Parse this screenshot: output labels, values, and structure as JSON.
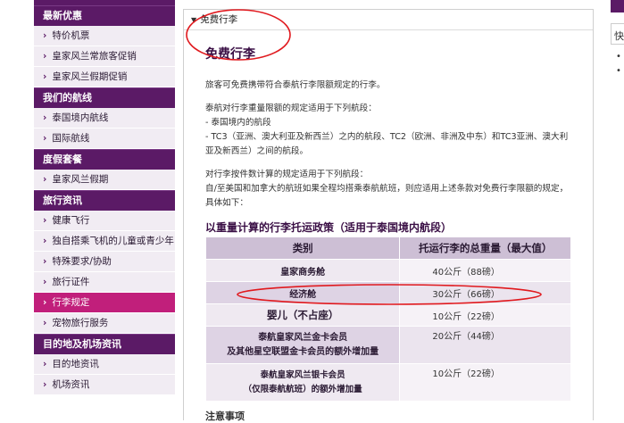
{
  "sidebar": {
    "sections": [
      {
        "header": "最新优惠",
        "items": [
          "特价机票",
          "皇家风兰常旅客促销",
          "皇家风兰假期促销"
        ]
      },
      {
        "header": "我们的航线",
        "items": [
          "泰国境内航线",
          "国际航线"
        ]
      },
      {
        "header": "度假套餐",
        "items": [
          "皇家风兰假期"
        ]
      },
      {
        "header": "旅行资讯",
        "items": [
          "健康飞行",
          "独自搭乘飞机的儿童或青少年",
          "特殊要求/协助",
          "旅行证件",
          "行李规定",
          "宠物旅行服务"
        ]
      },
      {
        "header": "目的地及机场资讯",
        "items": [
          "目的地资讯",
          "机场资讯"
        ]
      }
    ],
    "active_item": "行李规定"
  },
  "main": {
    "tab_label": "免费行李",
    "title": "免费行李",
    "paragraphs": [
      "旅客可免费携带符合泰航行李限额规定的行李。",
      "泰航对行李重量限额的规定适用于下列航段：",
      "- 泰国境内的航段",
      "- TC3（亚洲、澳大利亚及新西兰）之内的航段、TC2（欧洲、非洲及中东）和TC3亚洲、澳大利亚及新西兰）之间的航段。",
      "对行李按件数计算的规定适用于下列航段：",
      "自/至美国和加拿大的航班如果全程均搭乘泰航航班，则应适用上述条款对免费行李限额的规定，具体如下："
    ],
    "table_title": "以重量计算的行李托运政策（适用于泰国境内航段）",
    "table_headers": [
      "类别",
      "托运行李的总重量（最大值）"
    ],
    "table_rows": [
      {
        "category": "皇家商务舱",
        "weight": "40公斤（88磅）"
      },
      {
        "category": "经济舱",
        "weight": "30公斤（66磅）"
      },
      {
        "category": "婴儿（不占座）",
        "weight": "10公斤（22磅）"
      },
      {
        "category_line1": "泰航皇家风兰金卡会员",
        "category_line2": "及其他星空联盟金卡会员的额外增加量",
        "weight": "20公斤（44磅）"
      },
      {
        "category_line1": "泰航皇家风兰银卡会员",
        "category_line2": "（仅限泰航航班）的额外增加量",
        "weight": "10公斤（22磅）"
      }
    ],
    "note_title": "注意事项"
  },
  "right_fragment": {
    "box_text": "快"
  },
  "colors": {
    "brand_purple": "#5b1a66",
    "active_magenta": "#c11f7b",
    "annotation_red": "#e0191e"
  }
}
